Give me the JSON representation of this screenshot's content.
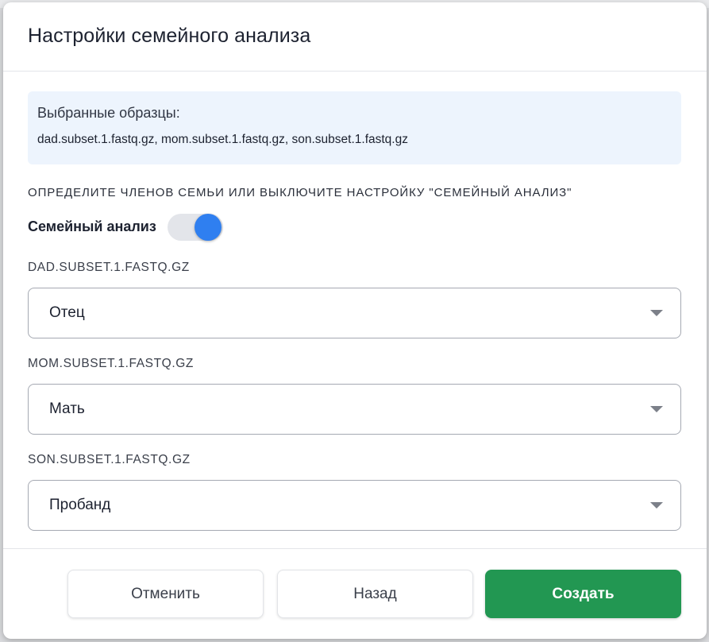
{
  "dialog": {
    "title": "Настройки семейного анализа"
  },
  "samples": {
    "label": "Выбранные образцы:",
    "value": "dad.subset.1.fastq.gz, mom.subset.1.fastq.gz, son.subset.1.fastq.gz"
  },
  "instruction": "ОПРЕДЕЛИТЕ ЧЛЕНОВ СЕМЬИ ИЛИ ВЫКЛЮЧИТЕ НАСТРОЙКУ \"СЕМЕЙНЫЙ АНАЛИЗ\"",
  "family_toggle": {
    "label": "Семейный анализ",
    "enabled": true
  },
  "members": [
    {
      "sample_label": "DAD.SUBSET.1.FASTQ.GZ",
      "role": "Отец"
    },
    {
      "sample_label": "MOM.SUBSET.1.FASTQ.GZ",
      "role": "Мать"
    },
    {
      "sample_label": "SON.SUBSET.1.FASTQ.GZ",
      "role": "Пробанд"
    }
  ],
  "footer": {
    "cancel_label": "Отменить",
    "back_label": "Назад",
    "create_label": "Создать"
  },
  "colors": {
    "accent_toggle": "#2f7ff0",
    "create_button": "#229752",
    "info_background": "#edf4fd"
  },
  "icons": {
    "select_caret": "chevron-down-icon"
  }
}
